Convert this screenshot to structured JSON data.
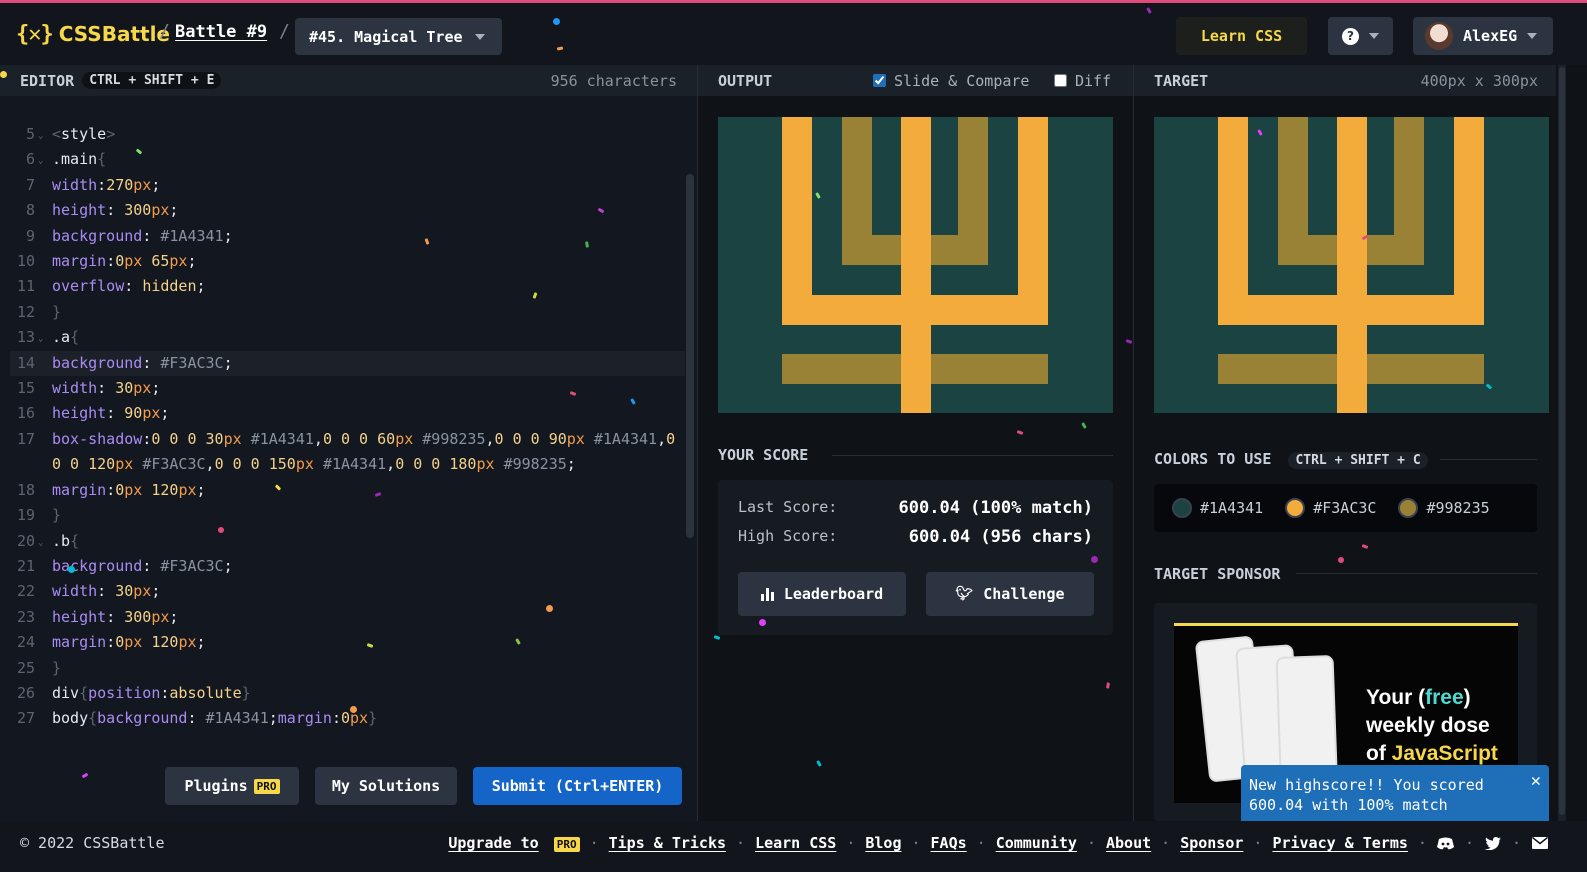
{
  "header": {
    "logo_text": "CSSBattle",
    "logo_mark": "{✕}",
    "breadcrumb_battle": "Battle #9",
    "target_select": "#45. Magical Tree",
    "learn_css": "Learn CSS",
    "user_name": "AlexEG"
  },
  "editor": {
    "title": "EDITOR",
    "shortcut": "CTRL + SHIFT + E",
    "char_count": "956 characters",
    "buttons": {
      "plugins": "Plugins",
      "pro_badge": "PRO",
      "my_solutions": "My Solutions",
      "submit": "Submit (Ctrl+ENTER)"
    }
  },
  "output": {
    "title": "OUTPUT",
    "slide_compare": "Slide & Compare",
    "slide_compare_checked": true,
    "diff": "Diff",
    "diff_checked": false
  },
  "target": {
    "title": "TARGET",
    "size": "400px x 300px"
  },
  "score": {
    "title": "YOUR SCORE",
    "last_label": "Last Score:",
    "last_value": "600.04 (100% match)",
    "high_label": "High Score:",
    "high_value": "600.04 (956 chars)",
    "leaderboard": "Leaderboard",
    "challenge": "Challenge"
  },
  "colors": {
    "title": "COLORS TO USE",
    "shortcut": "CTRL + SHIFT + C",
    "items": [
      {
        "hex": "#1A4341",
        "color": "#1A4341"
      },
      {
        "hex": "#F3AC3C",
        "color": "#F3AC3C"
      },
      {
        "hex": "#998235",
        "color": "#998235"
      }
    ]
  },
  "sponsor": {
    "title": "TARGET SPONSOR",
    "ad_line1": "Your (",
    "ad_free": "free",
    "ad_line1b": ")",
    "ad_line2": "weekly dose",
    "ad_line3": "of ",
    "ad_js": "JavaScript"
  },
  "toast": {
    "message": "New highscore!! You scored 600.04 with 100% match",
    "close": "✕"
  },
  "footer": {
    "copyright": "© 2022 CSSBattle",
    "upgrade": "Upgrade to",
    "pro": "PRO",
    "links": [
      "Tips & Tricks",
      "Learn CSS",
      "Blog",
      "FAQs",
      "Community",
      "About",
      "Sponsor",
      "Privacy & Terms"
    ]
  }
}
